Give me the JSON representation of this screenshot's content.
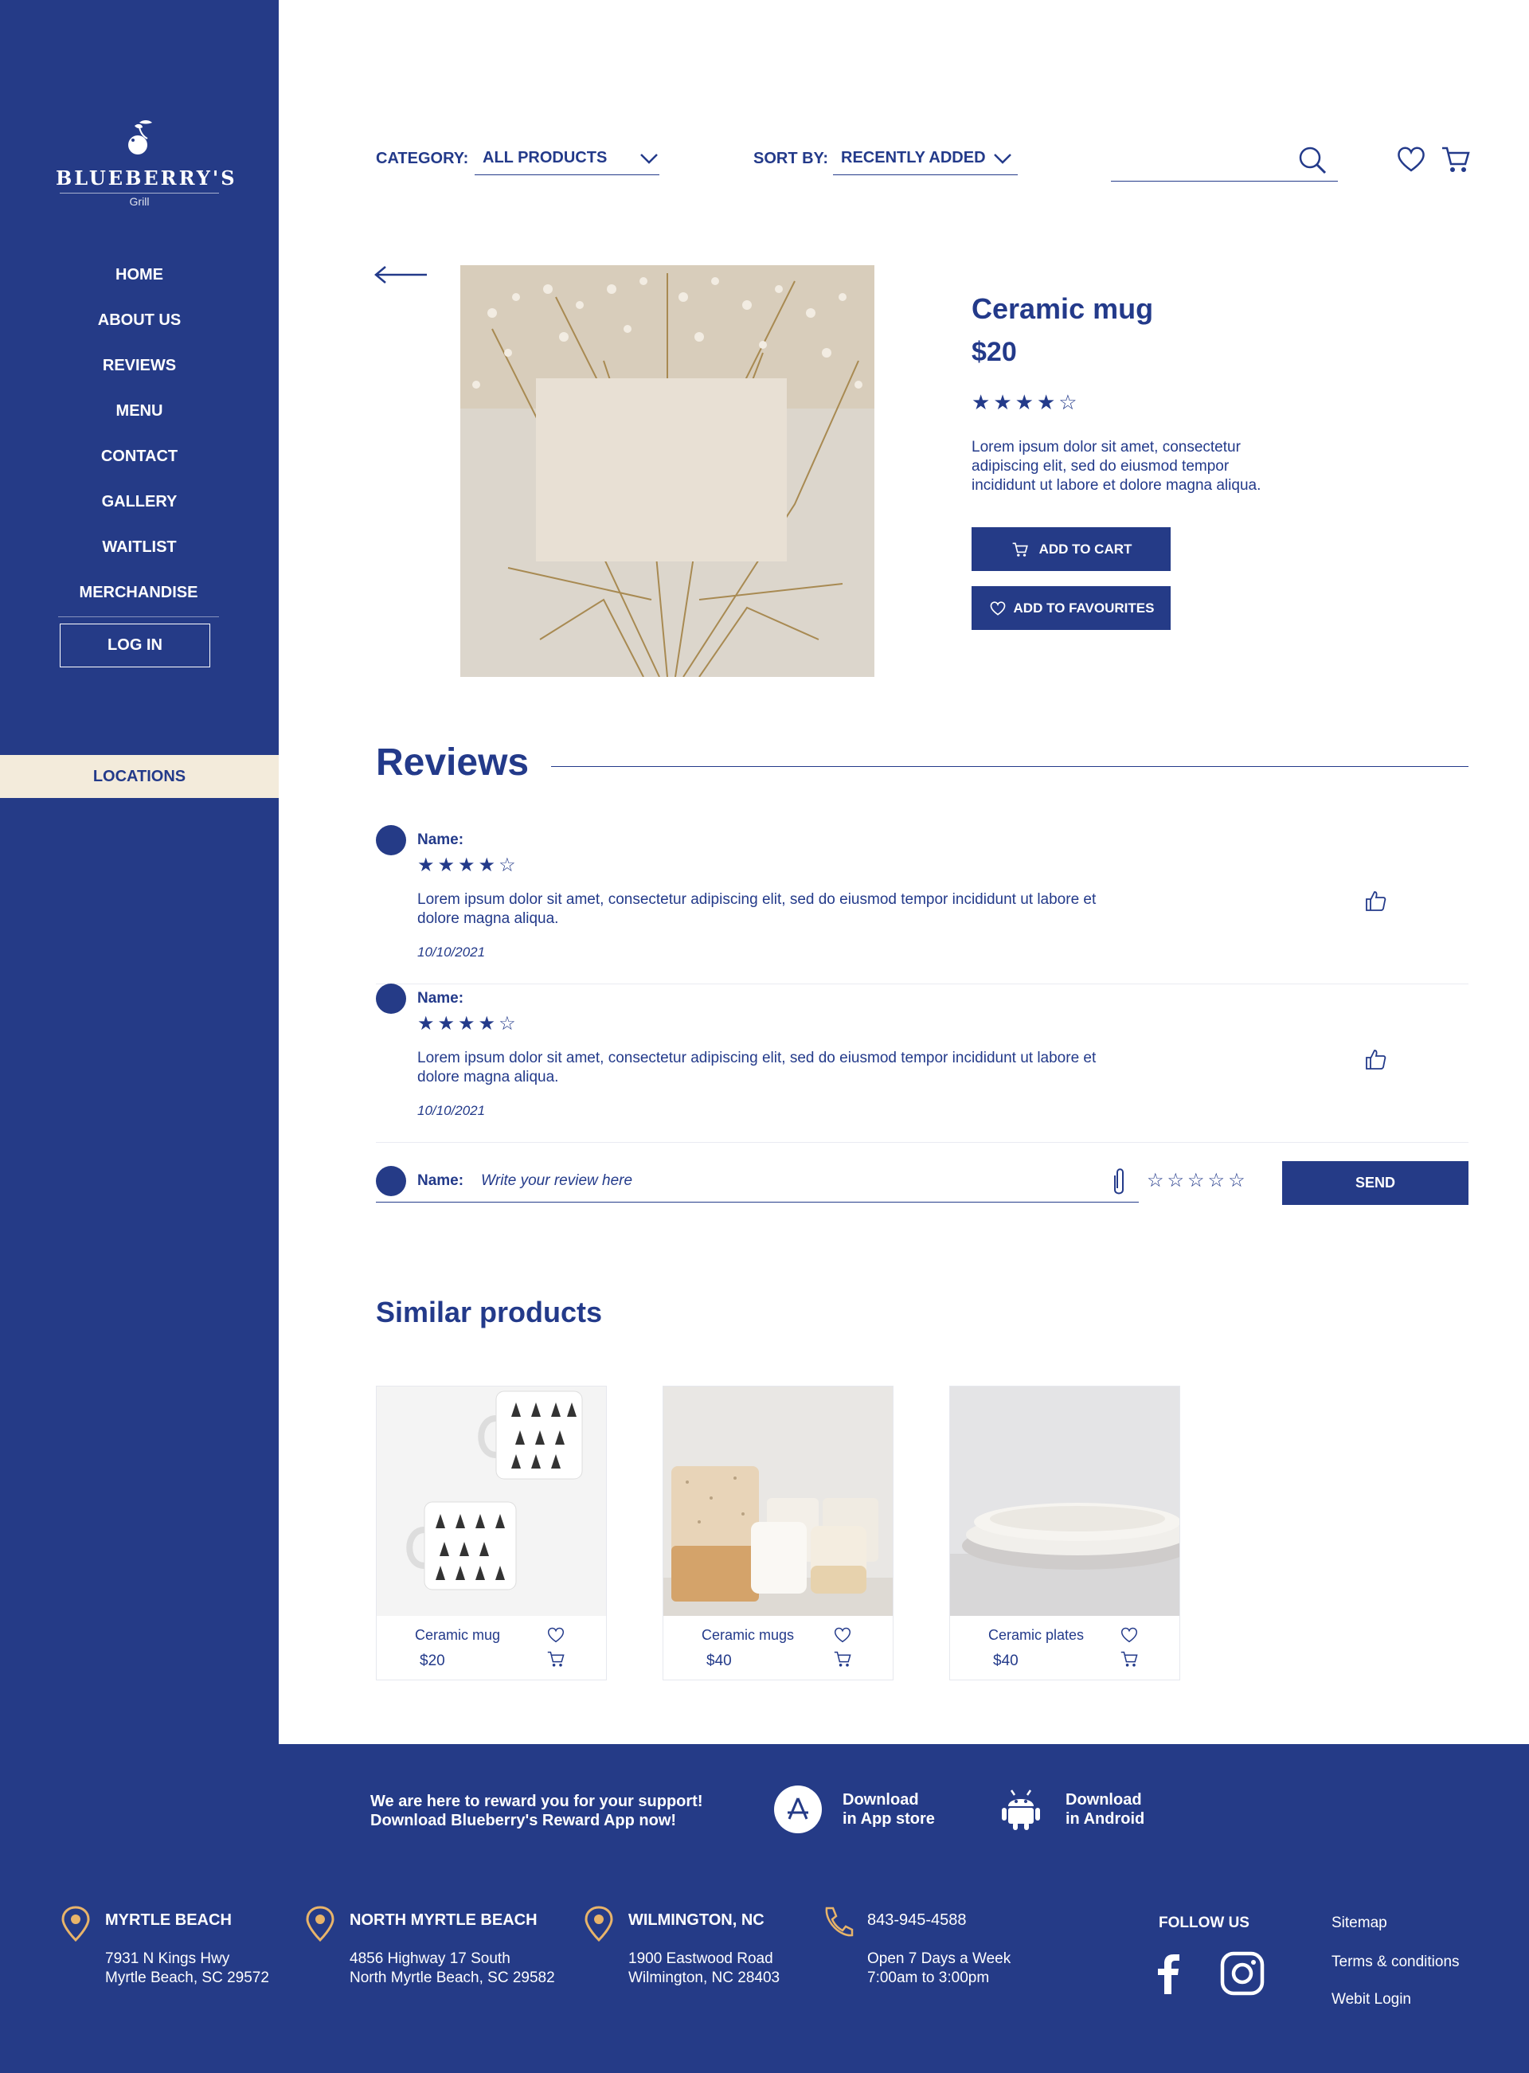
{
  "brand": {
    "name": "BLUEBERRY'S",
    "sub": "Grill"
  },
  "nav": {
    "items": [
      "HOME",
      "ABOUT US",
      "REVIEWS",
      "MENU",
      "CONTACT",
      "GALLERY",
      "WAITLIST",
      "MERCHANDISE"
    ],
    "login": "LOG IN",
    "locations": "LOCATIONS"
  },
  "filters": {
    "category_label": "CATEGORY:",
    "category_value": "ALL PRODUCTS",
    "sort_label": "SORT BY:",
    "sort_value": "RECENTLY ADDED",
    "search_placeholder": ""
  },
  "product": {
    "title": "Ceramic mug",
    "price": "$20",
    "rating": 4,
    "rating_max": 5,
    "description": "Lorem ipsum dolor sit amet, consectetur adipiscing elit, sed do eiusmod tempor incididunt ut labore et dolore magna aliqua.",
    "add_to_cart": "ADD TO CART",
    "add_to_favourites": "ADD TO FAVOURITES"
  },
  "reviews": {
    "title": "Reviews",
    "items": [
      {
        "name_label": "Name:",
        "rating": 4,
        "text": "Lorem ipsum dolor sit amet, consectetur adipiscing elit, sed do eiusmod tempor incididunt ut labore et dolore magna aliqua.",
        "date": "10/10/2021"
      },
      {
        "name_label": "Name:",
        "rating": 4,
        "text": "Lorem ipsum dolor sit amet, consectetur adipiscing elit, sed do eiusmod tempor incididunt ut labore et dolore magna aliqua.",
        "date": "10/10/2021"
      }
    ],
    "write": {
      "name_label": "Name:",
      "placeholder": "Write your review here",
      "rating": 0,
      "send": "SEND"
    }
  },
  "similar": {
    "title": "Similar products",
    "items": [
      {
        "name": "Ceramic mug",
        "price": "$20"
      },
      {
        "name": "Ceramic mugs",
        "price": "$40"
      },
      {
        "name": "Ceramic plates",
        "price": "$40"
      }
    ]
  },
  "footer": {
    "promo_line1": "We are here to reward you for your support!",
    "promo_line2": "Download Blueberry's Reward App now!",
    "appstore_line1": "Download",
    "appstore_line2": "in App store",
    "android_line1": "Download",
    "android_line2": "in Android",
    "locations": [
      {
        "title": "MYRTLE BEACH",
        "line1": "7931 N Kings Hwy",
        "line2": "Myrtle Beach, SC 29572"
      },
      {
        "title": "NORTH MYRTLE BEACH",
        "line1": "4856 Highway 17 South",
        "line2": "North Myrtle Beach, SC 29582"
      },
      {
        "title": "WILMINGTON, NC",
        "line1": "1900 Eastwood Road",
        "line2": "Wilmington, NC 28403"
      }
    ],
    "phone": {
      "number": "843-945-4588",
      "line1": "Open 7 Days a Week",
      "line2": "7:00am to 3:00pm"
    },
    "follow_us": "FOLLOW US",
    "links": [
      "Sitemap",
      "Terms & conditions",
      "Webit Login"
    ]
  },
  "colors": {
    "primary": "#253b87",
    "accent": "#f3ebdb",
    "pin": "#e8b46a"
  }
}
